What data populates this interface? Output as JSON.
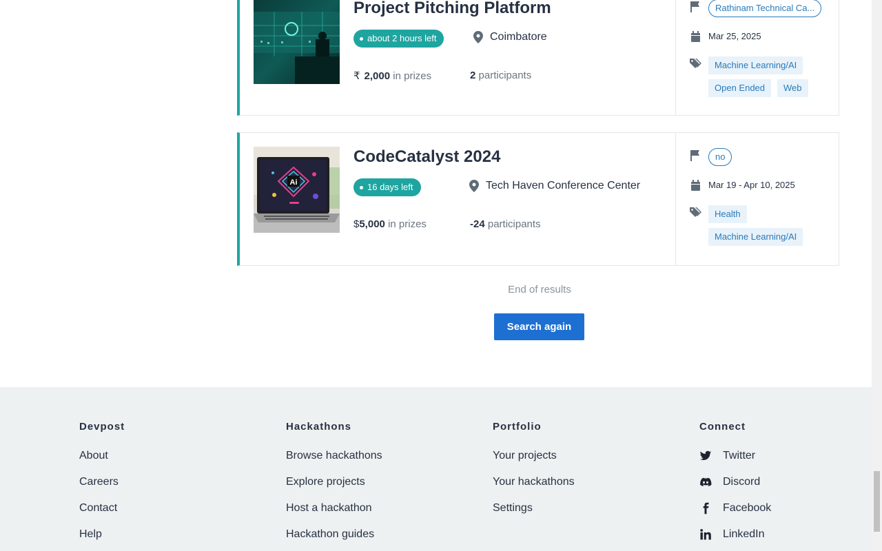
{
  "cards": [
    {
      "title": "Project Pitching Platform",
      "time_left": "about 2 hours left",
      "location": "Coimbatore",
      "prize_currency": "₹",
      "prize_amount": "2,000",
      "prize_suffix": "in prizes",
      "participants_count": "2",
      "participants_label": "participants",
      "host": "Rathinam Technical Ca...",
      "dates": "Mar 25, 2025",
      "tags": [
        "Machine Learning/AI",
        "Open Ended",
        "Web"
      ]
    },
    {
      "title": "CodeCatalyst 2024",
      "time_left": "16 days left",
      "location": "Tech Haven Conference Center",
      "prize_currency": "$",
      "prize_amount": "5,000",
      "prize_suffix": "in prizes",
      "participants_count": "-24",
      "participants_label": "participants",
      "host": "no",
      "dates": "Mar 19 - Apr 10, 2025",
      "tags": [
        "Health",
        "Machine Learning/AI"
      ],
      "thumb_text": "Ai"
    }
  ],
  "results": {
    "end_text": "End of results",
    "search_again": "Search again"
  },
  "footer": {
    "columns": [
      {
        "heading": "Devpost",
        "links": [
          "About",
          "Careers",
          "Contact",
          "Help"
        ]
      },
      {
        "heading": "Hackathons",
        "links": [
          "Browse hackathons",
          "Explore projects",
          "Host a hackathon",
          "Hackathon guides"
        ]
      },
      {
        "heading": "Portfolio",
        "links": [
          "Your projects",
          "Your hackathons",
          "Settings"
        ]
      },
      {
        "heading": "Connect",
        "links": [
          "Twitter",
          "Discord",
          "Facebook",
          "LinkedIn"
        ]
      }
    ],
    "connect_icons": [
      "twitter-icon",
      "discord-icon",
      "facebook-icon",
      "linkedin-icon"
    ]
  },
  "colors": {
    "accent_teal": "#1ea5a0",
    "link_blue": "#2a7ab8",
    "button_blue": "#1e6fd2",
    "footer_bg": "#eef1f1"
  }
}
